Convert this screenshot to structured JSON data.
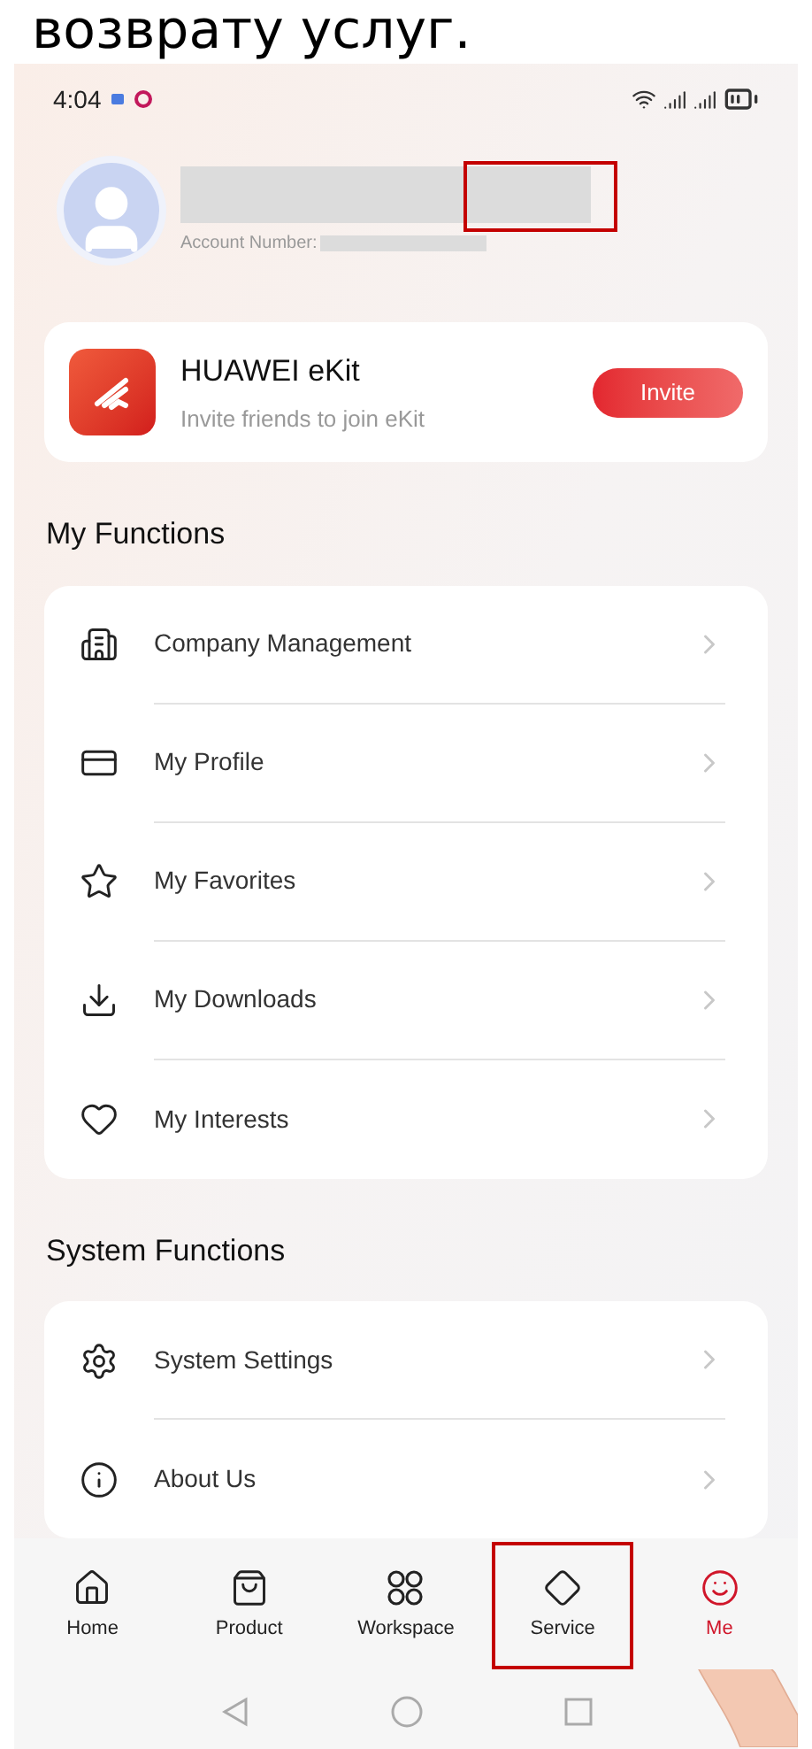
{
  "caption": "возврату услуг.",
  "status_bar": {
    "time": "4:04"
  },
  "profile": {
    "account_label": "Account Number:"
  },
  "promo": {
    "title": "HUAWEI eKit",
    "subtitle": "Invite friends to join eKit",
    "button": "Invite"
  },
  "sections": [
    {
      "title": "My Functions",
      "items": [
        {
          "label": "Company Management"
        },
        {
          "label": "My Profile"
        },
        {
          "label": "My Favorites"
        },
        {
          "label": "My Downloads"
        },
        {
          "label": "My Interests"
        }
      ]
    },
    {
      "title": "System Functions",
      "items": [
        {
          "label": "System Settings"
        },
        {
          "label": "About Us"
        }
      ]
    }
  ],
  "tabs": [
    {
      "label": "Home",
      "selected": false,
      "highlighted": false
    },
    {
      "label": "Product",
      "selected": false,
      "highlighted": false
    },
    {
      "label": "Workspace",
      "selected": false,
      "highlighted": false
    },
    {
      "label": "Service",
      "selected": false,
      "highlighted": true
    },
    {
      "label": "Me",
      "selected": true,
      "highlighted": false
    }
  ]
}
